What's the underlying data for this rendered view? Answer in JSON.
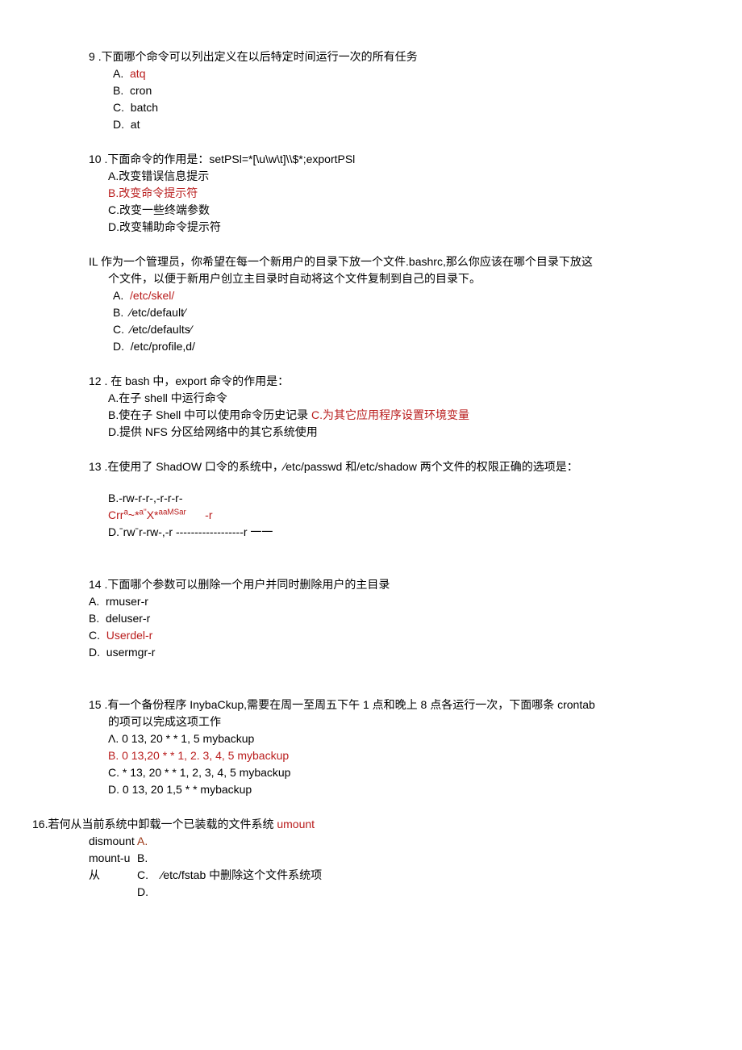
{
  "q9": {
    "num": "9",
    "text": ".下面哪个命令可以列出定义在以后特定时间运行一次的所有任务",
    "a": "A.",
    "a_text": "atq",
    "b": "B.",
    "b_text": "cron",
    "c": "C.",
    "c_text": "batch",
    "d": "D.",
    "d_text": "at"
  },
  "q10": {
    "num": "10",
    "text": ".下面命令的作用是：setPSl=*[\\u\\w\\t]\\\\$*;exportPSl",
    "a": "A.改变错误信息提示",
    "b": "B.改变命令提示符",
    "c": "C.改变一些终端参数",
    "d": "D.改变辅助命令提示符"
  },
  "q11": {
    "num": "IL",
    "text1": "作为一个管理员，你希望在每一个新用户的目录下放一个文件.bashrc,那么你应该在哪个目录下放这",
    "text2": "个文件，以便于新用户创立主目录时自动将这个文件复制到自己的目录下。",
    "a": "A.",
    "a_text": "/etc/skel/",
    "b": "B.",
    "b_text": "∕etc/default∕",
    "c": "C.",
    "c_text": "∕etc/defaults∕",
    "d": "D.",
    "d_text": "/etc/profile,d/"
  },
  "q12": {
    "num": "12",
    "text": ". 在 bash 中，export 命令的作用是：",
    "a": "A.在子 shell 中运行命令",
    "b": "B.使在子 Shell 中可以使用命令历史记录",
    "b_red": " C.为其它应用程序设置环境变量",
    "d": "D.提供 NFS 分区给网络中的其它系统使用"
  },
  "q13": {
    "num": "13",
    "text": ".在使用了 ShadOW 口令的系统中，∕etc/passwd 和/etc/shadow 两个文件的权限正确的选项是：",
    "b": "B.-rw-r-r-,-r-r-r-",
    "c1": "Crr",
    "c2": "a",
    "c3": "~*",
    "c4": "a''",
    "c5": "X*",
    "c6": "aaMSar",
    "c7": "-r",
    "d": "D.ˉrwˉr-rw-,-r ------------------r 一一"
  },
  "q14": {
    "num": "14",
    "text": ".下面哪个参数可以删除一个用户并同时删除用户的主目录",
    "a": "A.",
    "a_text": "rmuser-r",
    "b": "B.",
    "b_text": "deluser-r",
    "c": "C.",
    "c_text": "Userdel-r",
    "d": "D.",
    "d_text": "usermgr-r"
  },
  "q15": {
    "num": "15",
    "text1": ".有一个备份程序 InybaCkup,需要在周一至周五下午 1 点和晚上 8 点各运行一次，下面哪条 crontab",
    "text2": "的项可以完成这项工作",
    "a": "Λ.  0  13, 20  *   * 1, 5 mybackup",
    "b": "B.   0   13,20   *   * 1, 2. 3, 4, 5 mybackup",
    "c": "C.  *  13, 20  * *   1, 2, 3, 4, 5 mybackup",
    "d": "D.  0  13, 20  1,5   * * mybackup"
  },
  "q16": {
    "num": "16.",
    "text": "若何从当前系统中卸载一个已装载的文件系统 ",
    "text_red": "umount",
    "r1c1": "dismount",
    "r1c2": "A.",
    "r2c1": "mount-u",
    "r2c2": "B.",
    "r3c1": "从",
    "r3c2": "C.",
    "r3c3": "∕etc/fstab 中删除这个文件系统项",
    "r4c2": "D."
  }
}
